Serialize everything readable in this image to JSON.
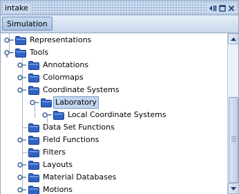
{
  "window": {
    "title": "intake",
    "buttons": [
      "minimize-restore-icon",
      "maximize-icon",
      "close-icon"
    ]
  },
  "toolbar": {
    "tab_label": "Simulation"
  },
  "tree": {
    "nodes": [
      {
        "label": "Representations",
        "expanded": false,
        "selected": false
      },
      {
        "label": "Tools",
        "expanded": true,
        "selected": false
      },
      {
        "label": "Annotations",
        "expanded": false,
        "selected": false
      },
      {
        "label": "Colormaps",
        "expanded": false,
        "selected": false
      },
      {
        "label": "Coordinate Systems",
        "expanded": true,
        "selected": false
      },
      {
        "label": "Laboratory",
        "expanded": true,
        "selected": true
      },
      {
        "label": "Local Coordinate Systems",
        "expanded": false,
        "selected": false
      },
      {
        "label": "Data Set Functions",
        "expanded": false,
        "selected": false
      },
      {
        "label": "Field Functions",
        "expanded": false,
        "selected": false
      },
      {
        "label": "Filters",
        "expanded": false,
        "selected": false
      },
      {
        "label": "Layouts",
        "expanded": false,
        "selected": false
      },
      {
        "label": "Material Databases",
        "expanded": false,
        "selected": false
      },
      {
        "label": "Motions",
        "expanded": false,
        "selected": false
      }
    ]
  },
  "colors": {
    "title_bg": "#c9d9ee",
    "folder_blue": "#2f63c4",
    "selection_bg": "#c3d6f0"
  }
}
